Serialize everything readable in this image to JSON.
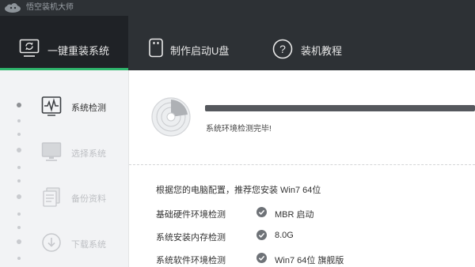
{
  "app": {
    "title": "悟空装机大师",
    "logo_icon": "cloud-logo-icon"
  },
  "nav": {
    "tabs": [
      {
        "label": "一键重装系统",
        "icon": "monitor-refresh-icon",
        "active": true
      },
      {
        "label": "制作启动U盘",
        "icon": "usb-drive-icon",
        "active": false
      },
      {
        "label": "装机教程",
        "icon": "help-circle-icon",
        "active": false
      }
    ],
    "accent_color": "#2fb56c"
  },
  "sidebar": {
    "steps": [
      {
        "label": "系统检测",
        "icon": "pulse-monitor-icon",
        "state": "active"
      },
      {
        "label": "选择系统",
        "icon": "monitor-icon",
        "state": "pending"
      },
      {
        "label": "备份资料",
        "icon": "documents-icon",
        "state": "pending"
      },
      {
        "label": "下载系统",
        "icon": "download-icon",
        "state": "pending"
      }
    ]
  },
  "main": {
    "progress": 1.0,
    "status_text": "系统环境检测完毕!",
    "recommendation": "根据您的电脑配置，推荐您安装 Win7 64位",
    "checks": [
      {
        "label": "基础硬件环境检测",
        "value": "MBR 启动"
      },
      {
        "label": "系统安装内存检测",
        "value": "8.0G"
      },
      {
        "label": "系统软件环境检测",
        "value": "Win7 64位 旗舰版"
      }
    ]
  }
}
